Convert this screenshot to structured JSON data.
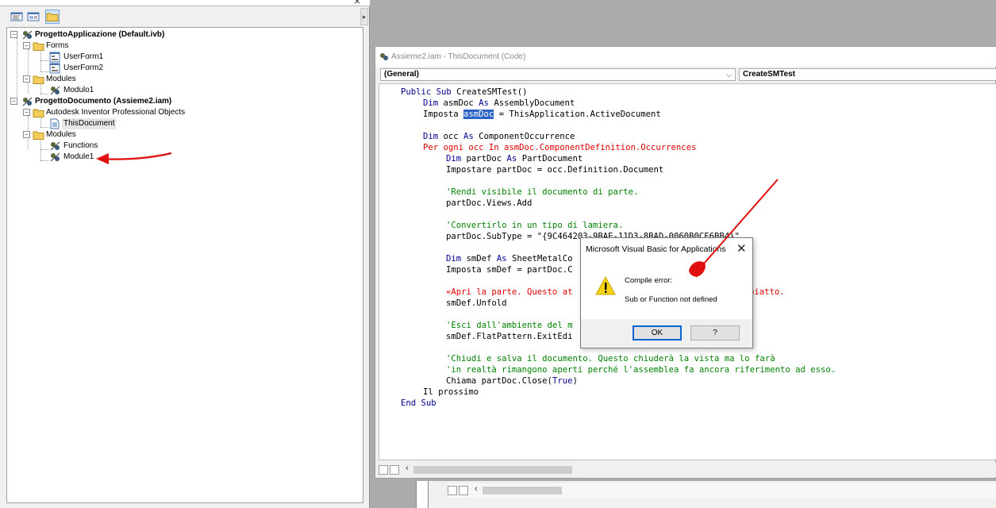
{
  "project_explorer": {
    "close_glyph": "×",
    "toolbar": {
      "view_code_icon": "view-code-icon",
      "view_object_icon": "view-object-icon",
      "toggle_folders_icon": "toggle-folders-icon"
    },
    "tree": {
      "project1": {
        "label": "ProgettoApplicazione (Default.ivb)"
      },
      "forms_folder": {
        "label": "Forms"
      },
      "userform1": {
        "label": "UserForm1"
      },
      "userform2": {
        "label": "UserForm2"
      },
      "modules_folder1": {
        "label": "Modules"
      },
      "modulo1": {
        "label": "Modulo1"
      },
      "project2": {
        "label": "ProgettoDocumento (Assieme2.iam)"
      },
      "objects_folder": {
        "label": "Autodesk Inventor Professional Objects"
      },
      "thisdocument": {
        "label": "ThisDocument"
      },
      "modules_folder2": {
        "label": "Modules"
      },
      "functions": {
        "label": "Functions"
      },
      "module1": {
        "label": "Module1"
      }
    }
  },
  "code_window": {
    "title": "Assieme2.iam - ThisDocument (Code)",
    "object_combo": "(General)",
    "procedure_combo": "CreateSMTest",
    "lines": {
      "l1a": "Public Sub ",
      "l1b": "CreateSMTest()",
      "l2a": "Dim ",
      "l2b": "asmDoc ",
      "l2c": "As ",
      "l2d": "AssemblyDocument",
      "l3a": "Imposta ",
      "l3b": "asmDoc",
      "l3c": " = ThisApplication.ActiveDocument",
      "l5a": "Dim ",
      "l5b": "occ ",
      "l5c": "As ",
      "l5d": "ComponentOccurrence",
      "l6": "Per ogni occ In asmDoc.ComponentDefinition.Occurrences",
      "l7a": "Dim ",
      "l7b": "partDoc ",
      "l7c": "As ",
      "l7d": "PartDocument",
      "l8": "Impostare partDoc = occ.Definition.Document",
      "l10": "'Rendi visibile il documento di parte.",
      "l11": "partDoc.Views.Add",
      "l13": "'Convertirlo in un tipo di lamiera.",
      "l14": "partDoc.SubType = \"{9C464203-9BAE-11D3-8BAD-0060B0CE6BB4}\"",
      "l16a": "Dim ",
      "l16b": "smDef ",
      "l16c": "As ",
      "l16d": "SheetMetalCo",
      "l17": "Imposta smDef = partDoc.C",
      "l19a": "«Apri la parte. Questo at",
      "l19b": "piatto.",
      "l20": "smDef.Unfold",
      "l22": "'Esci dall'ambiente del m",
      "l23": "smDef.FlatPattern.ExitEdi",
      "l25": "'Chiudi e salva il documento. Questo chiuderà la vista ma lo farà",
      "l26": "'in realtà rimangono aperti perché l'assemblea fa ancora riferimento ad esso.",
      "l27a": "Chiama partDoc.Close(",
      "l27b": "True",
      "l27c": ")",
      "l28": "Il prossimo",
      "l29a": "End Sub"
    }
  },
  "dialog": {
    "title": "Microsoft Visual Basic for Applications",
    "close_glyph": "✕",
    "message_title": "Compile error:",
    "message_body": "Sub or Function not defined",
    "ok_label": "OK",
    "help_label": "?"
  },
  "colors": {
    "keyword": "#00008b",
    "comment": "#008000",
    "error": "#e00000",
    "selection": "#2a63c6",
    "annotation": "#e01010"
  }
}
